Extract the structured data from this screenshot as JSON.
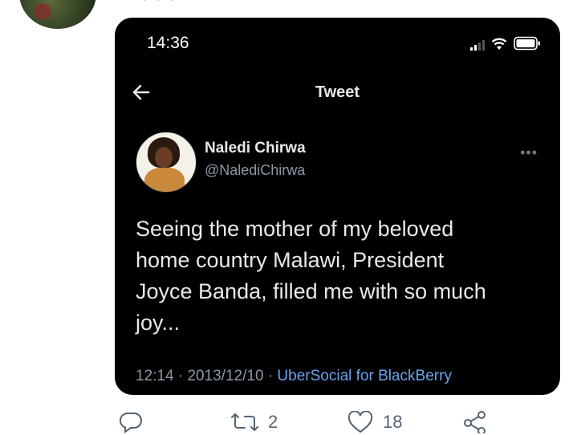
{
  "outer": {
    "top_clipped_text": "• • •"
  },
  "status_bar": {
    "time": "14:36",
    "icons": [
      "signal-icon",
      "wifi-icon",
      "battery-icon"
    ]
  },
  "nav": {
    "back_icon": "back-arrow-icon",
    "title": "Tweet"
  },
  "tweet": {
    "author_name": "Naledi Chirwa",
    "author_handle": "@NalediChirwa",
    "more_icon": "more-dots-icon",
    "more_glyph": "•••",
    "lines": [
      "Seeing the mother of my beloved",
      "home country Malawi, President",
      "Joyce Banda, filled me with so much",
      "joy..."
    ],
    "time": "12:14",
    "separator": "·",
    "date": "2013/12/10",
    "source": "UberSocial for BlackBerry"
  },
  "actions": {
    "reply": {
      "icon": "reply-icon",
      "count": ""
    },
    "retweet": {
      "icon": "retweet-icon",
      "count": "2"
    },
    "like": {
      "icon": "heart-icon",
      "count": "18"
    },
    "share": {
      "icon": "share-icon",
      "count": ""
    }
  },
  "colors": {
    "background": "#ffffff",
    "card": "#000000",
    "primary_text": "#e7e9ea",
    "secondary_text": "#8b98a5",
    "link": "#6aa3ee",
    "action_icons": "#536471"
  }
}
